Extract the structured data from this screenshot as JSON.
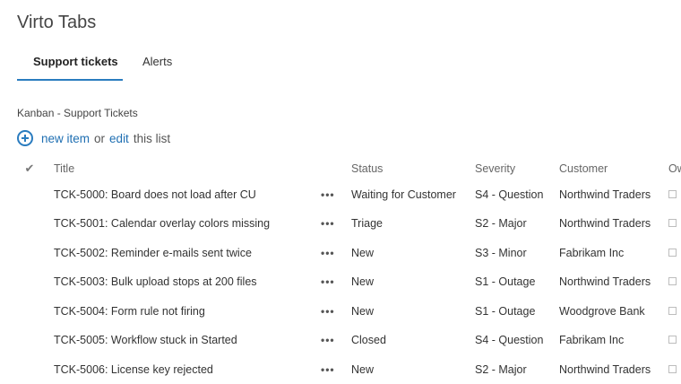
{
  "app": {
    "title": "Virto Tabs"
  },
  "tabs": [
    {
      "label": "Support tickets",
      "active": true
    },
    {
      "label": "Alerts",
      "active": false
    }
  ],
  "list": {
    "title": "Kanban - Support Tickets",
    "new_item_label": "new item",
    "or_text": "or",
    "edit_label": "edit",
    "this_list_text": "this list"
  },
  "columns": {
    "check": "✔",
    "title": "Title",
    "status": "Status",
    "severity": "Severity",
    "customer": "Customer",
    "owner": "Ow"
  },
  "row_menu_glyph": "•••",
  "rows": [
    {
      "title": "TCK-5000: Board does not load after CU",
      "status": "Waiting for Customer",
      "severity": "S4 - Question",
      "customer": "Northwind Traders"
    },
    {
      "title": "TCK-5001: Calendar overlay colors missing",
      "status": "Triage",
      "severity": "S2 - Major",
      "customer": "Northwind Traders"
    },
    {
      "title": "TCK-5002: Reminder e-mails sent twice",
      "status": "New",
      "severity": "S3 - Minor",
      "customer": "Fabrikam Inc"
    },
    {
      "title": "TCK-5003: Bulk upload stops at 200 files",
      "status": "New",
      "severity": "S1 - Outage",
      "customer": "Northwind Traders"
    },
    {
      "title": "TCK-5004: Form rule not firing",
      "status": "New",
      "severity": "S1 - Outage",
      "customer": "Woodgrove Bank"
    },
    {
      "title": "TCK-5005: Workflow stuck in Started",
      "status": "Closed",
      "severity": "S4 - Question",
      "customer": "Fabrikam Inc"
    },
    {
      "title": "TCK-5006: License key rejected",
      "status": "New",
      "severity": "S2 - Major",
      "customer": "Northwind Traders"
    }
  ],
  "colors": {
    "accent": "#2a7cbf",
    "link": "#1f6fb2"
  }
}
